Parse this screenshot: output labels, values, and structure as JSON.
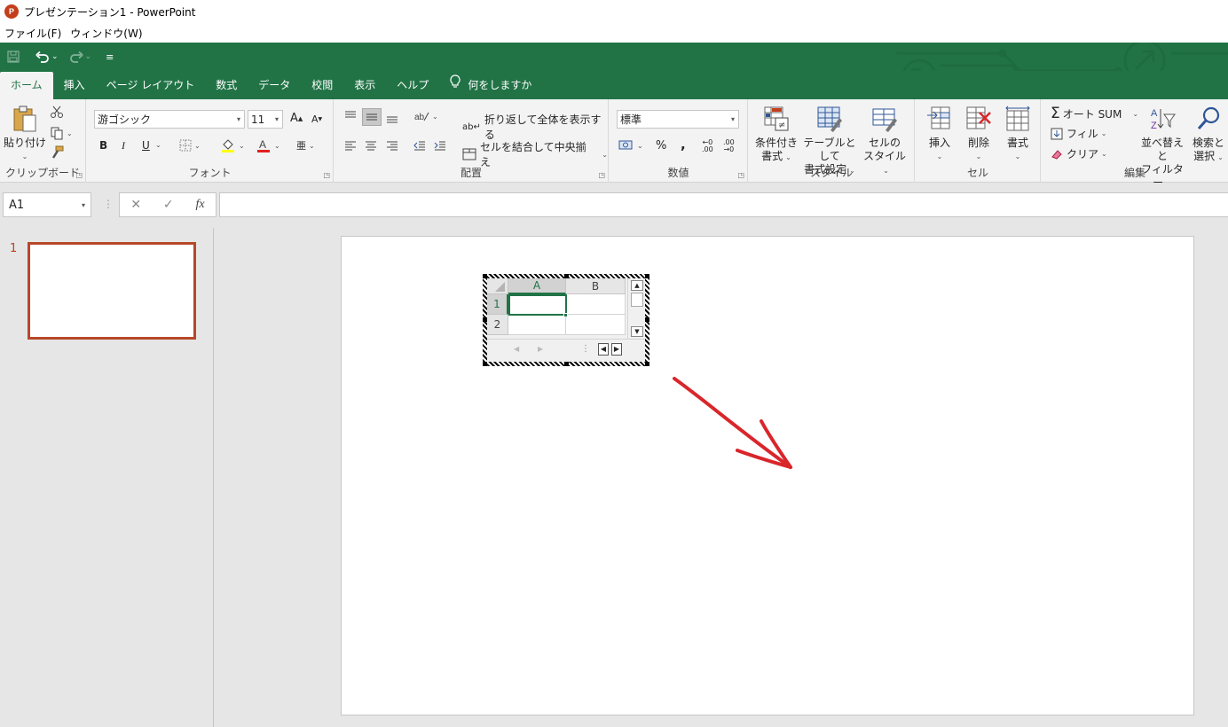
{
  "window": {
    "title": "プレゼンテーション1 - PowerPoint",
    "app_icon": "P"
  },
  "menubar": {
    "items": [
      "ファイル(F)",
      "ウィンドウ(W)"
    ]
  },
  "qat": {
    "save_icon": "save-icon",
    "undo_icon": "undo-icon",
    "redo_icon": "redo-icon"
  },
  "tabs": [
    "ホーム",
    "挿入",
    "ページ レイアウト",
    "数式",
    "データ",
    "校閲",
    "表示",
    "ヘルプ",
    "何をしますか"
  ],
  "ribbon": {
    "clipboard": {
      "label": "クリップボード",
      "paste": "貼り付け"
    },
    "font": {
      "label": "フォント",
      "name": "游ゴシック",
      "size": "11",
      "bold": "B",
      "italic": "I",
      "underline": "U"
    },
    "alignment": {
      "label": "配置",
      "wrap": "折り返して全体を表示する",
      "merge": "セルを結合して中央揃え"
    },
    "number": {
      "label": "数値",
      "format": "標準",
      "percent": "%",
      "comma": ","
    },
    "styles": {
      "label": "スタイル",
      "conditional": [
        "条件付き",
        "書式"
      ],
      "table": [
        "テーブルとして",
        "書式設定"
      ],
      "cell": [
        "セルの",
        "スタイル"
      ]
    },
    "cells": {
      "label": "セル",
      "insert": "挿入",
      "delete": "削除",
      "format": "書式"
    },
    "editing": {
      "label": "編集",
      "autosum": "オート SUM",
      "fill": "フィル",
      "clear": "クリア",
      "sort": [
        "並べ替えと",
        "フィルター"
      ],
      "find": [
        "検索と",
        "選択"
      ]
    }
  },
  "formula_bar": {
    "name_box": "A1",
    "fx": "fx",
    "cancel": "✕",
    "enter": "✓"
  },
  "thumbnails": {
    "slide_number": "1"
  },
  "embedded_sheet": {
    "columns": [
      "A",
      "B"
    ],
    "rows": [
      "1",
      "2"
    ]
  },
  "colors": {
    "accent": "#217346",
    "powerpoint": "#c43e1c",
    "arrow": "#d9262b"
  }
}
